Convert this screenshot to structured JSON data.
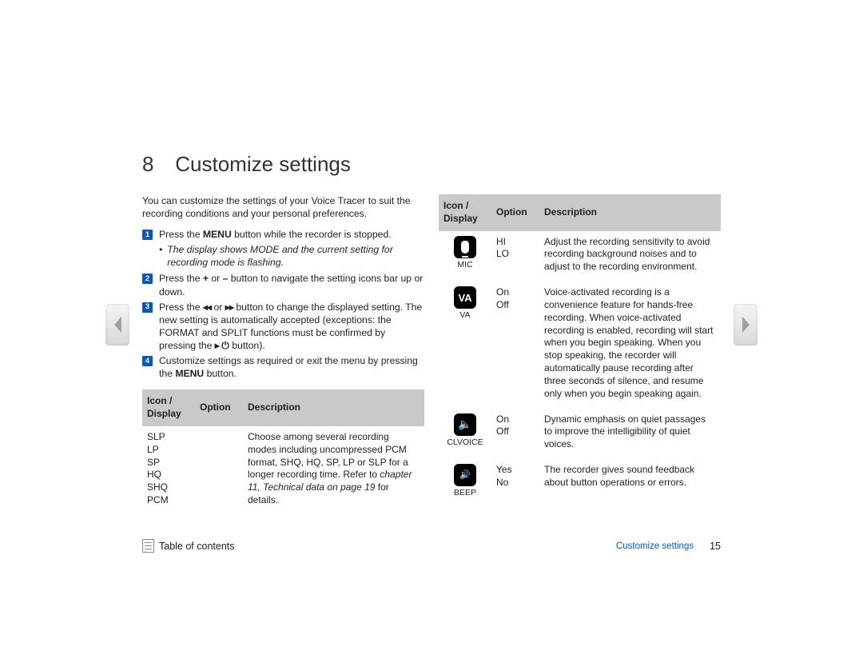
{
  "chapter_number": "8",
  "chapter_title": "Customize settings",
  "intro": "You can customize the settings of your Voice Tracer to suit the recording conditions and your personal preferences.",
  "steps": {
    "s1_a": "Press the ",
    "s1_bold": "MENU",
    "s1_b": " button while the recorder is stopped.",
    "s1_note": "The display shows MODE and the current setting for recording mode is flashing.",
    "s2_a": "Press the ",
    "s2_plus": "+",
    "s2_mid": " or ",
    "s2_minus": "–",
    "s2_b": " button to navigate the setting icons bar up or down.",
    "s3_a": "Press the ",
    "s3_prev": "◂◂",
    "s3_mid": " or ",
    "s3_next": "▸▸",
    "s3_b": " button to change the displayed setting. The new setting is automatically accepted (exceptions: the FORMAT and SPLIT functions must be confirmed by pressing the ",
    "s3_play": "▸",
    "s3_pwr": "⏻",
    "s3_c": " button).",
    "s4_a": "Customize settings as required or exit the menu by pressing the ",
    "s4_bold": "MENU",
    "s4_b": " button."
  },
  "table_headers": {
    "icon": "Icon / Display",
    "option": "Option",
    "description": "Description"
  },
  "left_table": {
    "row1": {
      "modes": [
        "SLP",
        "LP",
        "SP",
        "HQ",
        "SHQ",
        "PCM"
      ],
      "desc_a": "Choose among several recording modes including uncompressed PCM format, SHQ, HQ, SP, LP or SLP for a longer recording time. Refer to ",
      "desc_ref": "chapter 11, Technical data on page 19",
      "desc_b": " for details."
    }
  },
  "right_table": {
    "mic": {
      "label": "MIC",
      "opts": [
        "HI",
        "LO"
      ],
      "desc": "Adjust the recording sensitivity to avoid recording background noises and to adjust to the recording environment."
    },
    "va": {
      "label": "VA",
      "icon_text": "VA",
      "opts": [
        "On",
        "Off"
      ],
      "desc": "Voice-activated recording is a convenience feature for hands-free recording. When voice-activated recording is enabled, recording will start when you begin speaking. When you stop speaking, the recorder will automatically pause recording after three seconds of silence, and resume only when you begin speaking again."
    },
    "clvoice": {
      "label": "CLVOICE",
      "opts": [
        "On",
        "Off"
      ],
      "desc": "Dynamic emphasis on quiet passages to improve the intelligibility of quiet voices."
    },
    "beep": {
      "label": "BEEP",
      "opts": [
        "Yes",
        "No"
      ],
      "desc": "The recorder gives sound feedback about button operations or errors."
    }
  },
  "footer": {
    "toc": "Table of contents",
    "section": "Customize settings",
    "page": "15"
  }
}
